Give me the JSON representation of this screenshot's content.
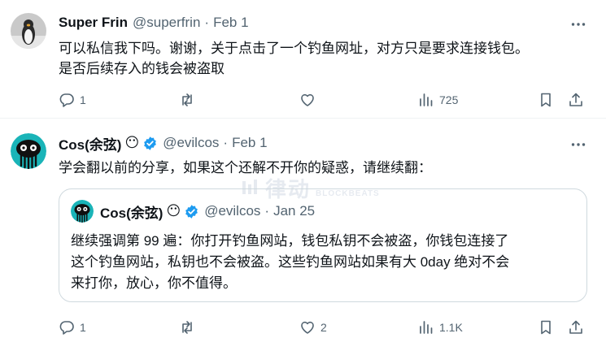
{
  "tweets": [
    {
      "author": {
        "name": "Super Frin",
        "handle": "@superfrin"
      },
      "separator": "·",
      "date": "Feb 1",
      "text": "可以私信我下吗。谢谢，关于点击了一个钓鱼网址，对方只是要求连接钱包。\n是否后续存入的钱会被盗取",
      "stats": {
        "replies": "1",
        "reposts": "",
        "likes": "",
        "views": "725"
      }
    },
    {
      "author": {
        "name": "Cos(余弦)",
        "badge": "😶",
        "handle": "@evilcos"
      },
      "separator": "·",
      "date": "Feb 1",
      "text": "学会翻以前的分享，如果这个还解不开你的疑惑，请继续翻：",
      "quote": {
        "author": {
          "name": "Cos(余弦)",
          "badge": "😶",
          "handle": "@evilcos"
        },
        "separator": "·",
        "date": "Jan 25",
        "text": "继续强调第 99 遍：你打开钓鱼网站，钱包私钥不会被盗，你钱包连接了\n这个钓鱼网站，私钥也不会被盗。这些钓鱼网站如果有大 0day 绝对不会\n来打你，放心，你不值得。"
      },
      "stats": {
        "replies": "1",
        "reposts": "",
        "likes": "2",
        "views": "1.1K"
      }
    }
  ],
  "watermark": {
    "text": "律动",
    "subtext": "BLOCKBEATS"
  },
  "colors": {
    "text": "#0f1419",
    "muted": "#536471",
    "verified": "#1d9bf0",
    "border": "#cfd9de"
  },
  "icons": [
    "reply-icon",
    "repost-icon",
    "like-icon",
    "views-icon",
    "bookmark-icon",
    "share-icon",
    "more-icon",
    "verified-icon"
  ]
}
